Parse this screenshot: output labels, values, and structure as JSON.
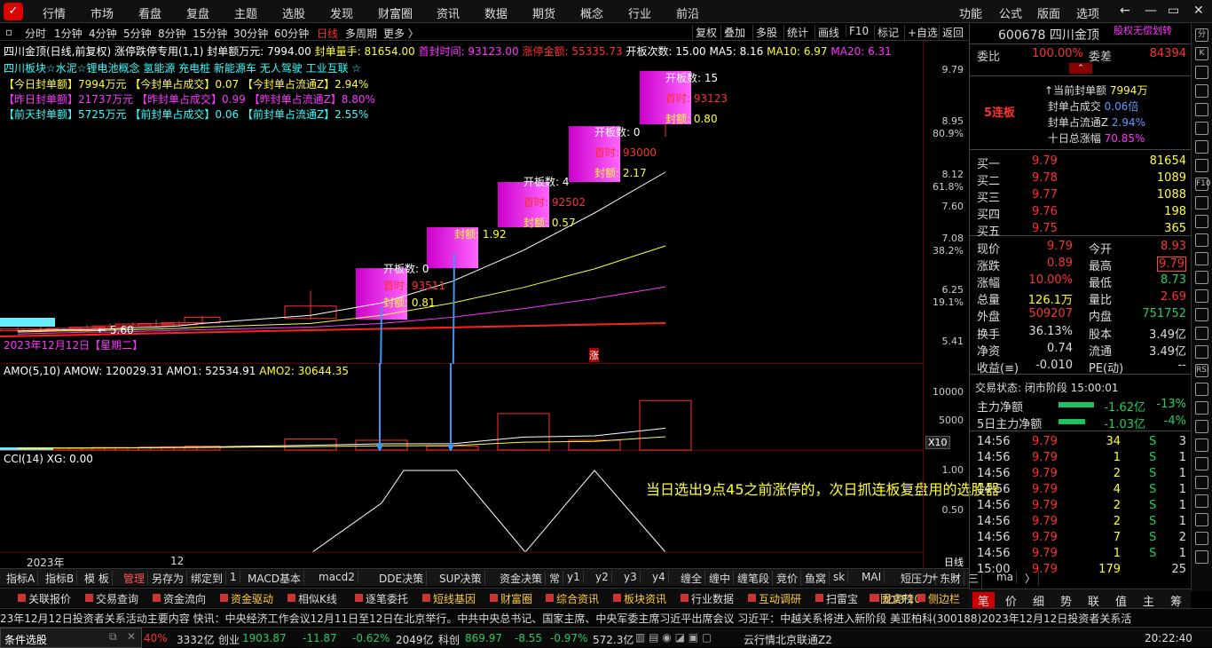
{
  "top_menu": [
    "行情",
    "市场",
    "看盘",
    "复盘",
    "主题",
    "选股",
    "发现",
    "财富圈",
    "资讯",
    "数据",
    "期货",
    "概念",
    "行业",
    "前沿"
  ],
  "top_right": [
    "功能",
    "公式",
    "版面",
    "选项"
  ],
  "periods": [
    "分时",
    "1分钟",
    "4分钟",
    "5分钟",
    "8分钟",
    "15分钟",
    "30分钟",
    "60分钟",
    "日线",
    "多周期",
    "更多 〉"
  ],
  "toolbar_right": [
    "复权",
    "叠加",
    "多股",
    "统计",
    "画线",
    "F10",
    "标记",
    "+自选",
    "返回"
  ],
  "info_line": {
    "title": "四川金顶(日线,前复权)",
    "indicator": "涨停跌停专用(1,1)",
    "fdje": "封单额万元: 7994.00",
    "fdl": "封单量手: 81654.00",
    "sfsj": "首封时间: 93123.00",
    "ztje": "涨停金额: 55335.73",
    "kbcs": "开板次数: 15.00",
    "ma5": "MA5: 8.16",
    "ma10": "MA10: 6.97",
    "ma20": "MA20: 6.31"
  },
  "concept_line": "四川板块☆水泥☆锂电池概念 氢能源 充电桩 新能源车 无人驾驶 工业互联 ☆",
  "stats_lines": [
    {
      "a": "【今日封单额】7994万元",
      "b": "【今封单占成交】0.07",
      "c": "【今封单占流通Z】2.94%",
      "color": "yellow"
    },
    {
      "a": "【昨日封单额】21737万元",
      "b": "【昨封单占成交】0.99",
      "c": "【昨封单占流通Z】8.80%",
      "color": "mag"
    },
    {
      "a": "【前天封单额】5725万元",
      "b": "【前封单占成交】0.06",
      "c": "【前封单占流通Z】2.55%",
      "color": "cyan"
    }
  ],
  "price_axis": [
    "9.79",
    "8.95",
    "80.9%",
    "8.12",
    "61.8%",
    "7.60",
    "7.08",
    "38.2%",
    "6.25",
    "19.1%",
    "5.41"
  ],
  "annotations": [
    {
      "kb": "开板数:  15",
      "sf": "首时:  93123",
      "fe": "封额:  0.80"
    },
    {
      "kb": "开板数:  0",
      "sf": "首时:  93000",
      "fe": "封额:  2.17"
    },
    {
      "kb": "开板数:  4",
      "sf": "首时:  92502",
      "fe": "封额:  0.57"
    },
    {
      "kb": "",
      "sf": "",
      "fe": "封额:  1.92"
    },
    {
      "kb": "开板数:  0",
      "sf": "首时:  93511",
      "fe": "封额:  0.81"
    }
  ],
  "low_label": "← 5.60",
  "date_label": "2023年12月12日【星期二】",
  "zhang_mark": "涨",
  "vol_info": {
    "title": "AMO(5,10)",
    "amow": "AMOW: 120029.31",
    "amo1": "AMO1: 52534.91",
    "amo2": "AMO2: 30644.35"
  },
  "vol_axis": [
    "10000",
    "5000",
    "X10"
  ],
  "cci_info": {
    "title": "CCI(14)",
    "xg": "XG: 0.00"
  },
  "cci_axis": [
    "1.00",
    "0.50"
  ],
  "overlay_text": "当日选出9点45之前涨停的，次日抓连板复盘用的选股器",
  "x_axis": [
    "2023年",
    "12",
    "日线"
  ],
  "right_panel": {
    "code_name": "600678 四川金顶",
    "tag": "股权无偿划转",
    "weibi_label": "委比",
    "weibi": "100.00%",
    "weicha_label": "委差",
    "weicha": "84394",
    "lianban": "5连板",
    "seal_info": [
      {
        "k": "当前封单额",
        "v": "7994万"
      },
      {
        "k": "封单占成交",
        "v": "0.06倍"
      },
      {
        "k": "封单占流通Z",
        "v": "2.94%"
      },
      {
        "k": "十日总涨幅",
        "v": "70.85%"
      }
    ],
    "bids": [
      {
        "n": "买一",
        "p": "9.79",
        "v": "81654"
      },
      {
        "n": "买二",
        "p": "9.78",
        "v": "1089"
      },
      {
        "n": "买三",
        "p": "9.77",
        "v": "1088"
      },
      {
        "n": "买四",
        "p": "9.76",
        "v": "198"
      },
      {
        "n": "买五",
        "p": "9.75",
        "v": "365"
      }
    ],
    "quote": [
      {
        "k1": "现价",
        "v1": "9.79",
        "c1": "red",
        "k2": "今开",
        "v2": "8.93",
        "c2": "red"
      },
      {
        "k1": "涨跌",
        "v1": "0.89",
        "c1": "red",
        "k2": "最高",
        "v2": "9.79",
        "c2": "red"
      },
      {
        "k1": "涨幅",
        "v1": "10.00%",
        "c1": "red",
        "k2": "最低",
        "v2": "8.73",
        "c2": "green"
      },
      {
        "k1": "总量",
        "v1": "126.1万",
        "c1": "yellow",
        "k2": "量比",
        "v2": "2.69",
        "c2": "red"
      },
      {
        "k1": "外盘",
        "v1": "509207",
        "c1": "red",
        "k2": "内盘",
        "v2": "751752",
        "c2": "green"
      }
    ],
    "quote2": [
      {
        "k1": "换手",
        "v1": "36.13%",
        "k2": "股本",
        "v2": "3.49亿"
      },
      {
        "k1": "净资",
        "v1": "0.74",
        "k2": "流通",
        "v2": "3.49亿"
      },
      {
        "k1": "收益(≡)",
        "v1": "-0.010",
        "k2": "PE(动)",
        "v2": "--"
      }
    ],
    "trade_state": "交易状态: 闭市阶段 15:00:01",
    "flow": [
      {
        "k": "主力净额",
        "v": "-1.62亿",
        "p": "-13%"
      },
      {
        "k": "5日主力净额",
        "v": "-1.03亿",
        "p": "-4%"
      }
    ],
    "ticks": [
      {
        "t": "14:56",
        "p": "9.79",
        "v": "34",
        "s": "S",
        "n": "3"
      },
      {
        "t": "14:56",
        "p": "9.79",
        "v": "1",
        "s": "S",
        "n": "1"
      },
      {
        "t": "14:56",
        "p": "9.79",
        "v": "2",
        "s": "S",
        "n": "1"
      },
      {
        "t": "14:56",
        "p": "9.79",
        "v": "4",
        "s": "S",
        "n": "1"
      },
      {
        "t": "14:56",
        "p": "9.79",
        "v": "2",
        "s": "S",
        "n": "1"
      },
      {
        "t": "14:56",
        "p": "9.79",
        "v": "2",
        "s": "S",
        "n": "1"
      },
      {
        "t": "14:56",
        "p": "9.79",
        "v": "7",
        "s": "S",
        "n": "2"
      },
      {
        "t": "14:56",
        "p": "9.79",
        "v": "1",
        "s": "S",
        "n": "1"
      },
      {
        "t": "15:00",
        "p": "9.79",
        "v": "179",
        "s": "",
        "n": "25"
      }
    ]
  },
  "bottom_tabs": [
    "指标A",
    "指标B",
    "模 板",
    "管理",
    "另存为",
    "绑定到",
    "1",
    "MACD基本",
    "macd2",
    "DDE决策",
    "SUP决策",
    "资金决策",
    "常",
    "y1",
    "y2",
    "y3",
    "y4",
    "缠全",
    "缠中",
    "缠笔段",
    "竞价",
    "鱼窝",
    "sk",
    "MAI",
    "短压力",
    "东财",
    "三角",
    "ma",
    "〉"
  ],
  "func_buttons": [
    "关联报价",
    "交易查询",
    "资金流向",
    "资金驱动",
    "相似K线",
    "逐笔委托",
    "短线基因",
    "财富圈",
    "综合资讯",
    "板块资讯",
    "行业数据",
    "互动调研",
    "扫雷宝",
    "龙虎榜"
  ],
  "func_right": [
    "图文F10",
    "侧边栏"
  ],
  "right_tabs": [
    "笔",
    "价",
    "细",
    "势",
    "联",
    "值",
    "主",
    "筹"
  ],
  "news_text": "23年12月12日投资者关系活动主要内容      快讯：中央经济工作会议12月11日至12日在北京举行。中共中央总书记、国家主席、中央军委主席习近平出席会议      习近平：中越关系将进入新阶段      美亚柏科(300188)2023年12月12日投资者关系活",
  "status": {
    "panel": "条件选股",
    "pct": "40%",
    "amt": "3332亿",
    "cy_label": "创业",
    "cy": "1903.87",
    "cy_chg": "-11.87",
    "cy_pct": "-0.62%",
    "cy_amt": "2049亿",
    "kc_label": "科创",
    "kc": "869.97",
    "kc_chg": "-8.55",
    "kc_pct": "-0.97%",
    "kc_amt": "572.3亿",
    "server": "云行情北京联通Z2",
    "time": "20:22:40"
  },
  "side_icons": [
    "分",
    "K",
    "",
    "",
    "",
    "",
    "",
    "",
    "F10",
    "",
    "",
    "",
    "",
    "",
    "",
    "",
    "",
    "",
    "RSI",
    "",
    "",
    "",
    "",
    "",
    "",
    "",
    "",
    "",
    ""
  ],
  "chart_data": {
    "type": "candlestick",
    "series": [
      {
        "name": "K",
        "ohlc": [
          [
            5.62,
            5.66,
            5.58,
            5.63
          ],
          [
            5.63,
            5.68,
            5.6,
            5.62
          ],
          [
            5.62,
            5.65,
            5.59,
            5.64
          ],
          [
            5.64,
            5.7,
            5.6,
            5.66
          ],
          [
            5.66,
            5.72,
            5.62,
            5.68
          ],
          [
            5.7,
            5.74,
            5.64,
            5.71
          ],
          [
            5.72,
            5.78,
            5.66,
            5.68
          ],
          [
            5.7,
            5.76,
            5.68,
            5.73
          ],
          [
            5.73,
            5.84,
            5.7,
            5.82
          ],
          [
            5.8,
            6.25,
            5.78,
            6.0
          ],
          [
            6.0,
            6.61,
            6.0,
            6.61
          ],
          [
            6.61,
            7.27,
            6.8,
            7.27
          ],
          [
            7.27,
            8.0,
            7.27,
            8.0
          ],
          [
            8.0,
            8.9,
            8.0,
            8.9
          ],
          [
            8.93,
            9.79,
            8.73,
            9.79
          ]
        ]
      }
    ],
    "amo": [
      300,
      320,
      280,
      340,
      400,
      380,
      450,
      500,
      600,
      1700,
      1500,
      600,
      5600,
      1500,
      7600
    ],
    "ma5": [
      5.6,
      5.61,
      5.62,
      5.62,
      5.63,
      5.65,
      5.66,
      5.68,
      5.72,
      5.85,
      6.05,
      6.4,
      6.9,
      7.5,
      8.16
    ],
    "ma10": [
      5.58,
      5.59,
      5.6,
      5.6,
      5.61,
      5.62,
      5.63,
      5.64,
      5.66,
      5.72,
      5.85,
      6.05,
      6.3,
      6.6,
      6.97
    ],
    "ma20": [
      5.55,
      5.56,
      5.57,
      5.58,
      5.58,
      5.59,
      5.6,
      5.61,
      5.62,
      5.66,
      5.72,
      5.82,
      5.96,
      6.12,
      6.31
    ],
    "cci": [
      0,
      0,
      0,
      0,
      0,
      0,
      0,
      0,
      0,
      0.6,
      1.0,
      1.0,
      0,
      1.0,
      0
    ]
  }
}
